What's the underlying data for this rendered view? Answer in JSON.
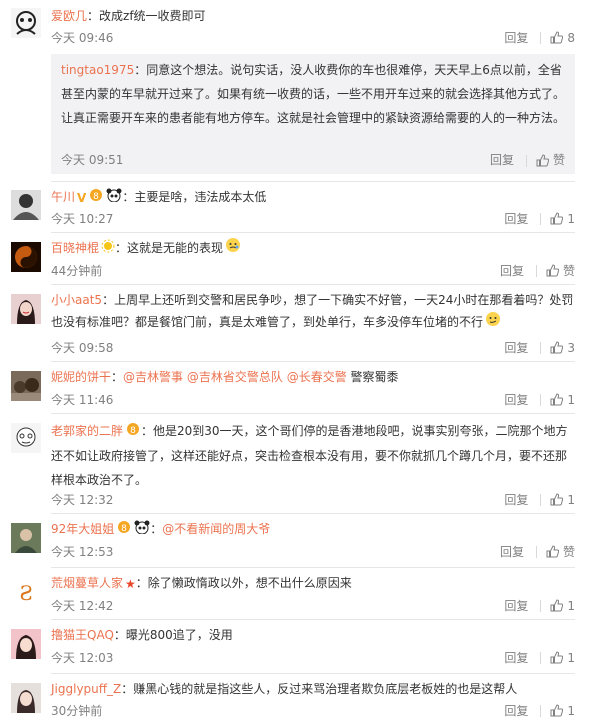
{
  "reply_label": "回复",
  "like_label": "赞",
  "comments": [
    {
      "user": "爱欧几",
      "text": "：改成zf统一收费即可",
      "time": "今天 09:46",
      "likes": "8",
      "reply": {
        "user": "tingtao1975",
        "text": "：同意这个想法。说句实话，没人收费你的车也很难停，天天早上6点以前，全省甚至内蒙的车早就开过来了。如果有统一收费的话，一些不用开车过来的就会选择其他方式了。让真正需要开车来的患者能有地方停车。这就是社会管理中的紧缺资源给需要的人的一种方法。",
        "time": "今天 09:51",
        "likes": "赞"
      }
    },
    {
      "user": "午川",
      "text": "：主要是啥，违法成本太低",
      "time": "今天 10:27",
      "likes": "1"
    },
    {
      "user": "百晓神棍",
      "text": "：这就是无能的表现",
      "time": "44分钟前",
      "likes": "赞"
    },
    {
      "user": "小小aat5",
      "text": "：上周早上还听到交警和居民争吵，想了一下确实不好管，一天24小时在那看着吗？处罚也没有标准吧？都是餐馆门前，真是太难管了，到处单行，车多没停车位堵的不行",
      "time": "今天 09:58",
      "likes": "3"
    },
    {
      "user": "妮妮的饼干",
      "mentions": [
        "@吉林警事",
        "@吉林省交警总队",
        "@长春交警"
      ],
      "text_after": " 警察蜀黍",
      "time": "今天 11:46",
      "likes": "1"
    },
    {
      "user": "老郭家的二胖",
      "text": "：他是20到30一天，这个哥们停的是香港地段吧，说事实别夸张，二院那个地方还不如让政府接管了，这样还能好点，突击检查根本没有用，要不你就抓几个蹲几个月，要不还那样根本政治不了。",
      "time": "今天 12:32",
      "likes": "1"
    },
    {
      "user": "92年大姐姐",
      "mentions": [
        "@不看新闻的周大爷"
      ],
      "time": "今天 12:53",
      "likes": "赞"
    },
    {
      "user": "荒烟蔓草人家",
      "text": "：除了懒政惰政以外，想不出什么原因来",
      "time": "今天 12:42",
      "likes": "1"
    },
    {
      "user": "撸猫王QAQ",
      "text": "：曝光800追了，没用",
      "time": "今天 12:03",
      "likes": "1"
    },
    {
      "user": "Jigglypuff_Z",
      "text": "：赚黑心钱的就是指这些人，反过来骂治理者欺负底层老板姓的也是这帮人",
      "time": "30分钟前",
      "likes": "1"
    }
  ]
}
